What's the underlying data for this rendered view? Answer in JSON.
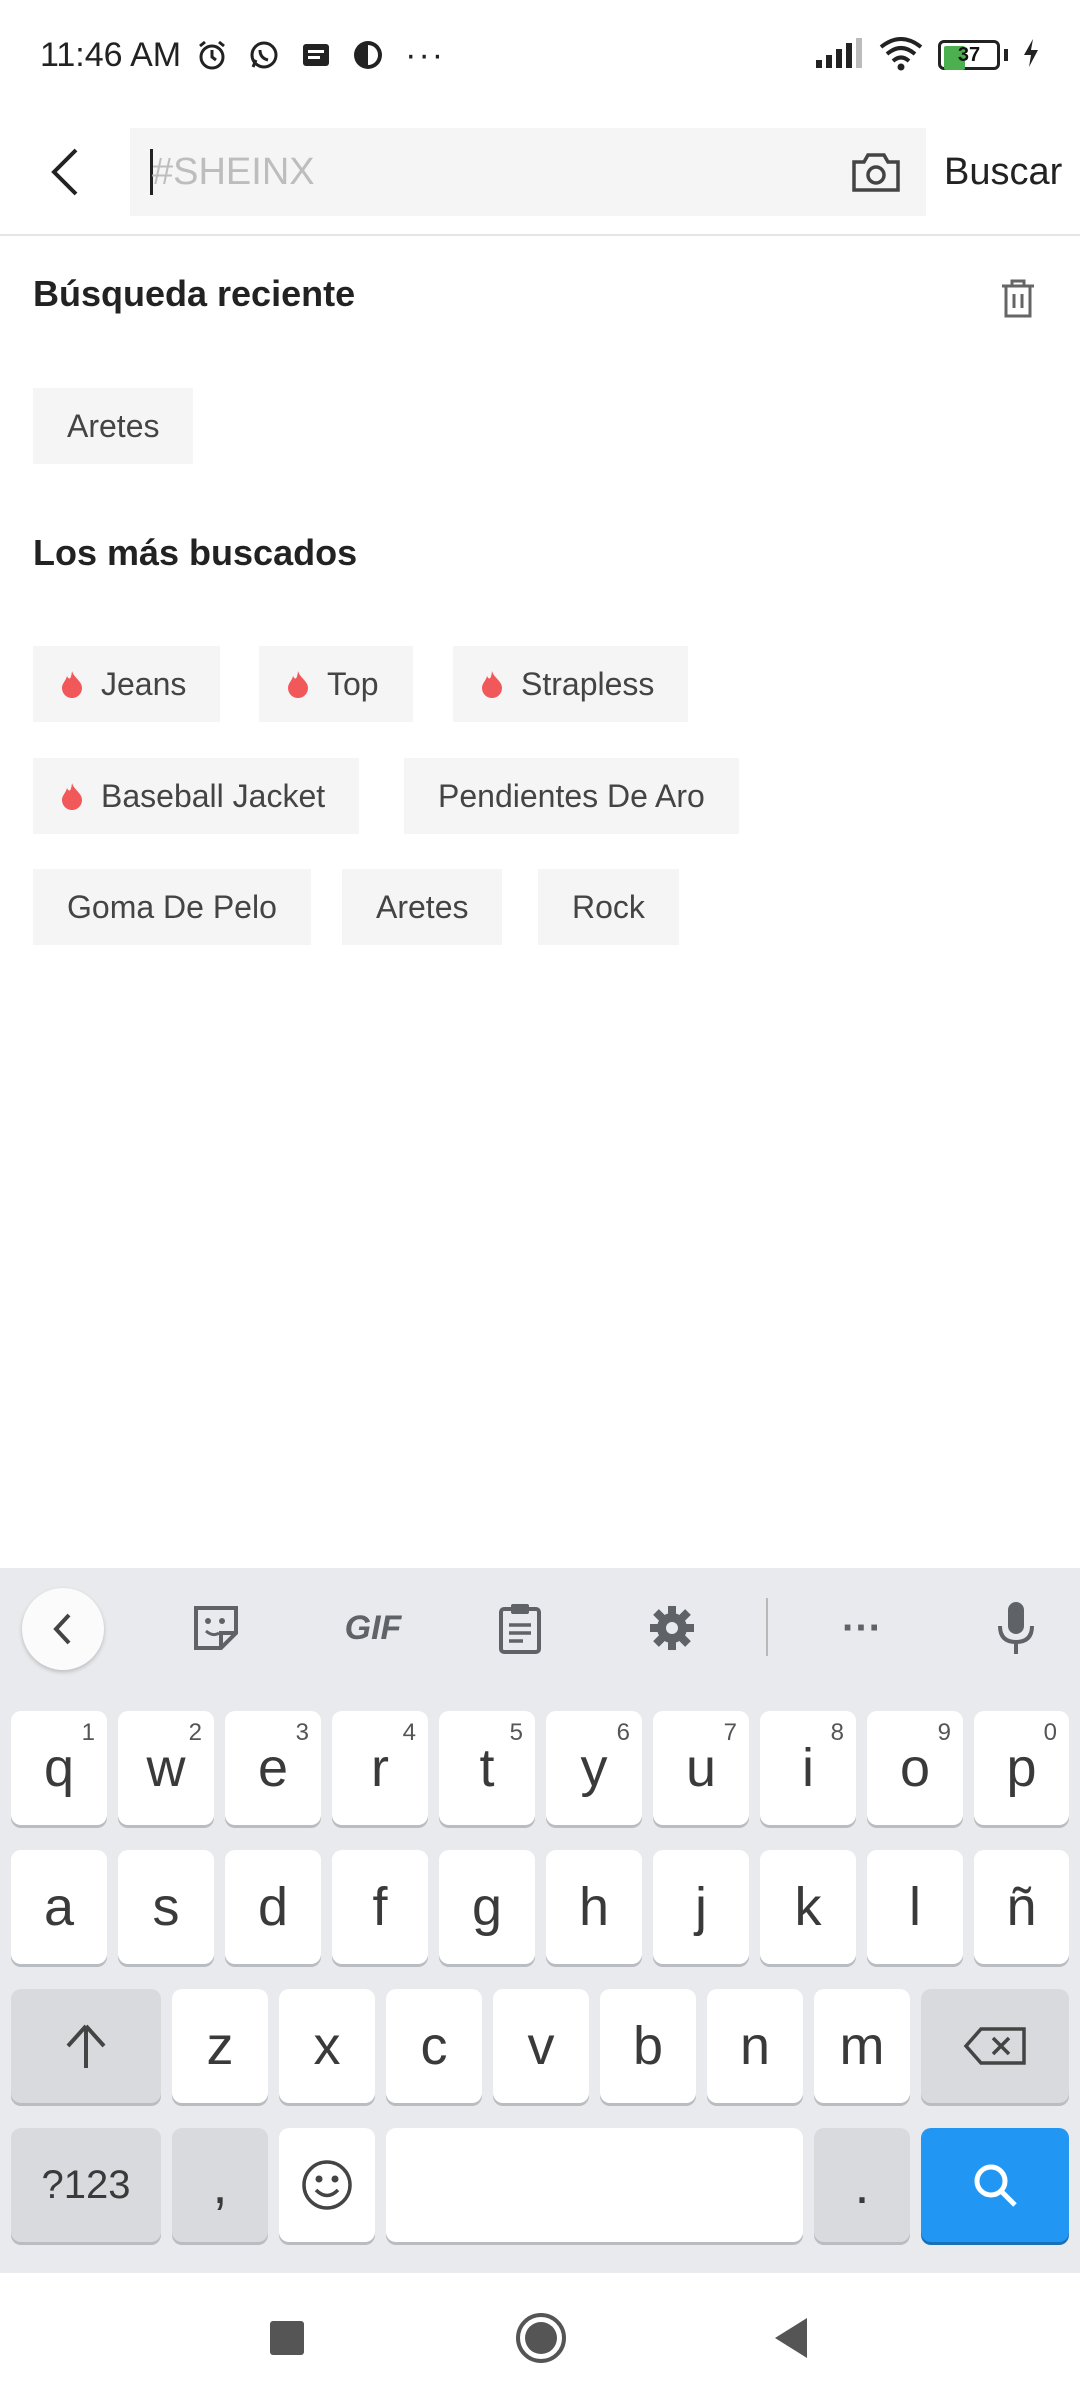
{
  "status_bar": {
    "time": "11:46 AM",
    "battery_level": "37",
    "icons": [
      "alarm-icon",
      "whatsapp-icon",
      "message-icon",
      "app-icon",
      "more-dots"
    ],
    "dots": "···"
  },
  "search": {
    "placeholder": "#SHEINX",
    "value": "",
    "submit_label": "Buscar"
  },
  "recent": {
    "title": "Búsqueda reciente",
    "items": [
      "Aretes"
    ]
  },
  "popular": {
    "title": "Los más buscados",
    "items": [
      {
        "label": "Jeans",
        "hot": true
      },
      {
        "label": "Top",
        "hot": true
      },
      {
        "label": "Strapless",
        "hot": true
      },
      {
        "label": "Baseball Jacket",
        "hot": true
      },
      {
        "label": "Pendientes De Aro",
        "hot": false
      },
      {
        "label": "Goma De Pelo",
        "hot": false
      },
      {
        "label": "Aretes",
        "hot": false
      },
      {
        "label": "Rock",
        "hot": false
      }
    ],
    "hot_color": "#f0585a"
  },
  "keyboard": {
    "toolbar": {
      "gif_label": "GIF",
      "more_label": "···"
    },
    "row1": [
      {
        "k": "q",
        "h": "1"
      },
      {
        "k": "w",
        "h": "2"
      },
      {
        "k": "e",
        "h": "3"
      },
      {
        "k": "r",
        "h": "4"
      },
      {
        "k": "t",
        "h": "5"
      },
      {
        "k": "y",
        "h": "6"
      },
      {
        "k": "u",
        "h": "7"
      },
      {
        "k": "i",
        "h": "8"
      },
      {
        "k": "o",
        "h": "9"
      },
      {
        "k": "p",
        "h": "0"
      }
    ],
    "row2": [
      "a",
      "s",
      "d",
      "f",
      "g",
      "h",
      "j",
      "k",
      "l",
      "ñ"
    ],
    "row3": [
      "z",
      "x",
      "c",
      "v",
      "b",
      "n",
      "m"
    ],
    "symbols_label": "?123",
    "comma_label": ",",
    "period_label": ".",
    "accent_color": "#2196f3"
  }
}
